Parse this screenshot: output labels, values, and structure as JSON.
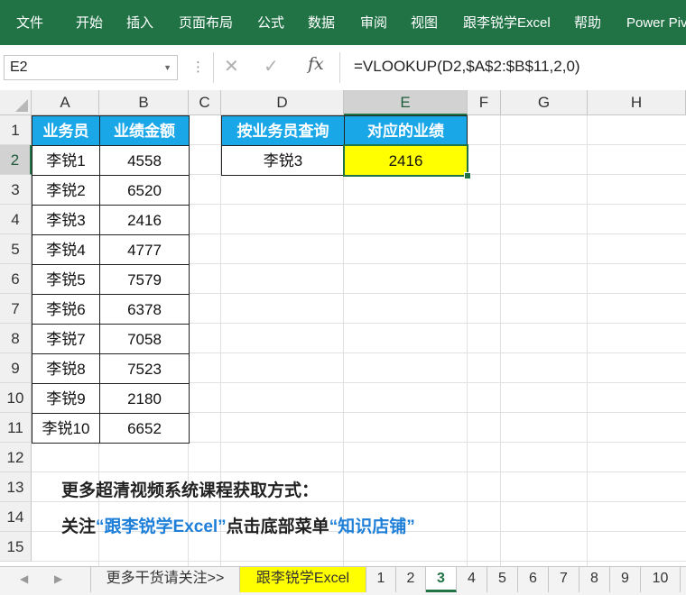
{
  "ribbon": {
    "tabs": [
      "文件",
      "开始",
      "插入",
      "页面布局",
      "公式",
      "数据",
      "审阅",
      "视图",
      "跟李锐学Excel",
      "帮助",
      "Power Pivot"
    ]
  },
  "formula_bar": {
    "name_box": "E2",
    "cancel_icon": "✕",
    "enter_icon": "✓",
    "fx_label": "fx",
    "formula": "=VLOOKUP(D2,$A$2:$B$11,2,0)"
  },
  "columns": [
    "A",
    "B",
    "C",
    "D",
    "E",
    "F",
    "G",
    "H"
  ],
  "rows": [
    "1",
    "2",
    "3",
    "4",
    "5",
    "6",
    "7",
    "8",
    "9",
    "10",
    "11",
    "12",
    "13",
    "14",
    "15"
  ],
  "table": {
    "headers": [
      "业务员",
      "业绩金额"
    ],
    "rows": [
      [
        "李锐1",
        "4558"
      ],
      [
        "李锐2",
        "6520"
      ],
      [
        "李锐3",
        "2416"
      ],
      [
        "李锐4",
        "4777"
      ],
      [
        "李锐5",
        "7579"
      ],
      [
        "李锐6",
        "6378"
      ],
      [
        "李锐7",
        "7058"
      ],
      [
        "李锐8",
        "7523"
      ],
      [
        "李锐9",
        "2180"
      ],
      [
        "李锐10",
        "6652"
      ]
    ]
  },
  "lookup": {
    "headers": [
      "按业务员查询",
      "对应的业绩"
    ],
    "query": "李锐3",
    "result": "2416"
  },
  "promo": {
    "line1": "更多超清视频系统课程获取方式：",
    "line2_a": "关注",
    "line2_b": "“跟李锐学Excel”",
    "line2_c": "点击底部菜单",
    "line2_d": "“知识店铺”"
  },
  "sheet_tabs": [
    "更多干货请关注>>",
    "跟李锐学Excel",
    "1",
    "2",
    "3",
    "4",
    "5",
    "6",
    "7",
    "8",
    "9",
    "10"
  ],
  "colors": {
    "ribbon": "#217346",
    "header_fill": "#19A7E8",
    "result_fill": "#FFFF00",
    "promo_blue": "#1E7FD8"
  }
}
